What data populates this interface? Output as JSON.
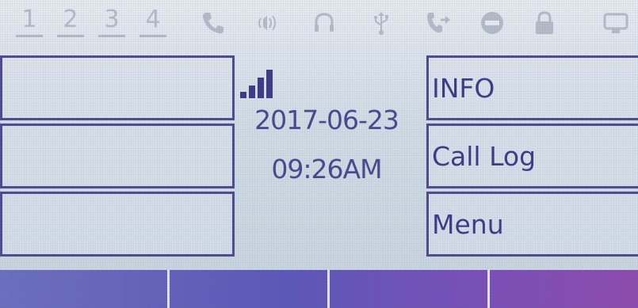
{
  "status_bar": {
    "lines": [
      "1",
      "2",
      "3",
      "4"
    ],
    "icons": [
      "handset-icon",
      "speaker-icon",
      "headset-icon",
      "usb-icon",
      "call-forward-icon",
      "do-not-disturb-icon",
      "lock-icon",
      "network-icon"
    ]
  },
  "left_keys": [
    {
      "label": ""
    },
    {
      "label": ""
    },
    {
      "label": ""
    }
  ],
  "right_keys": [
    {
      "label": "INFO"
    },
    {
      "label": "Call Log"
    },
    {
      "label": "Menu"
    }
  ],
  "center": {
    "date": "2017-06-23",
    "time": "09:26AM",
    "signal_bars": 4
  },
  "function_keys": [
    {
      "label": ""
    },
    {
      "label": ""
    },
    {
      "label": ""
    },
    {
      "label": ""
    }
  ],
  "colors": {
    "lcd_text": "#3d3a88",
    "status_icon": "#b4bcc9",
    "function_bar": "#6c6fbf"
  }
}
